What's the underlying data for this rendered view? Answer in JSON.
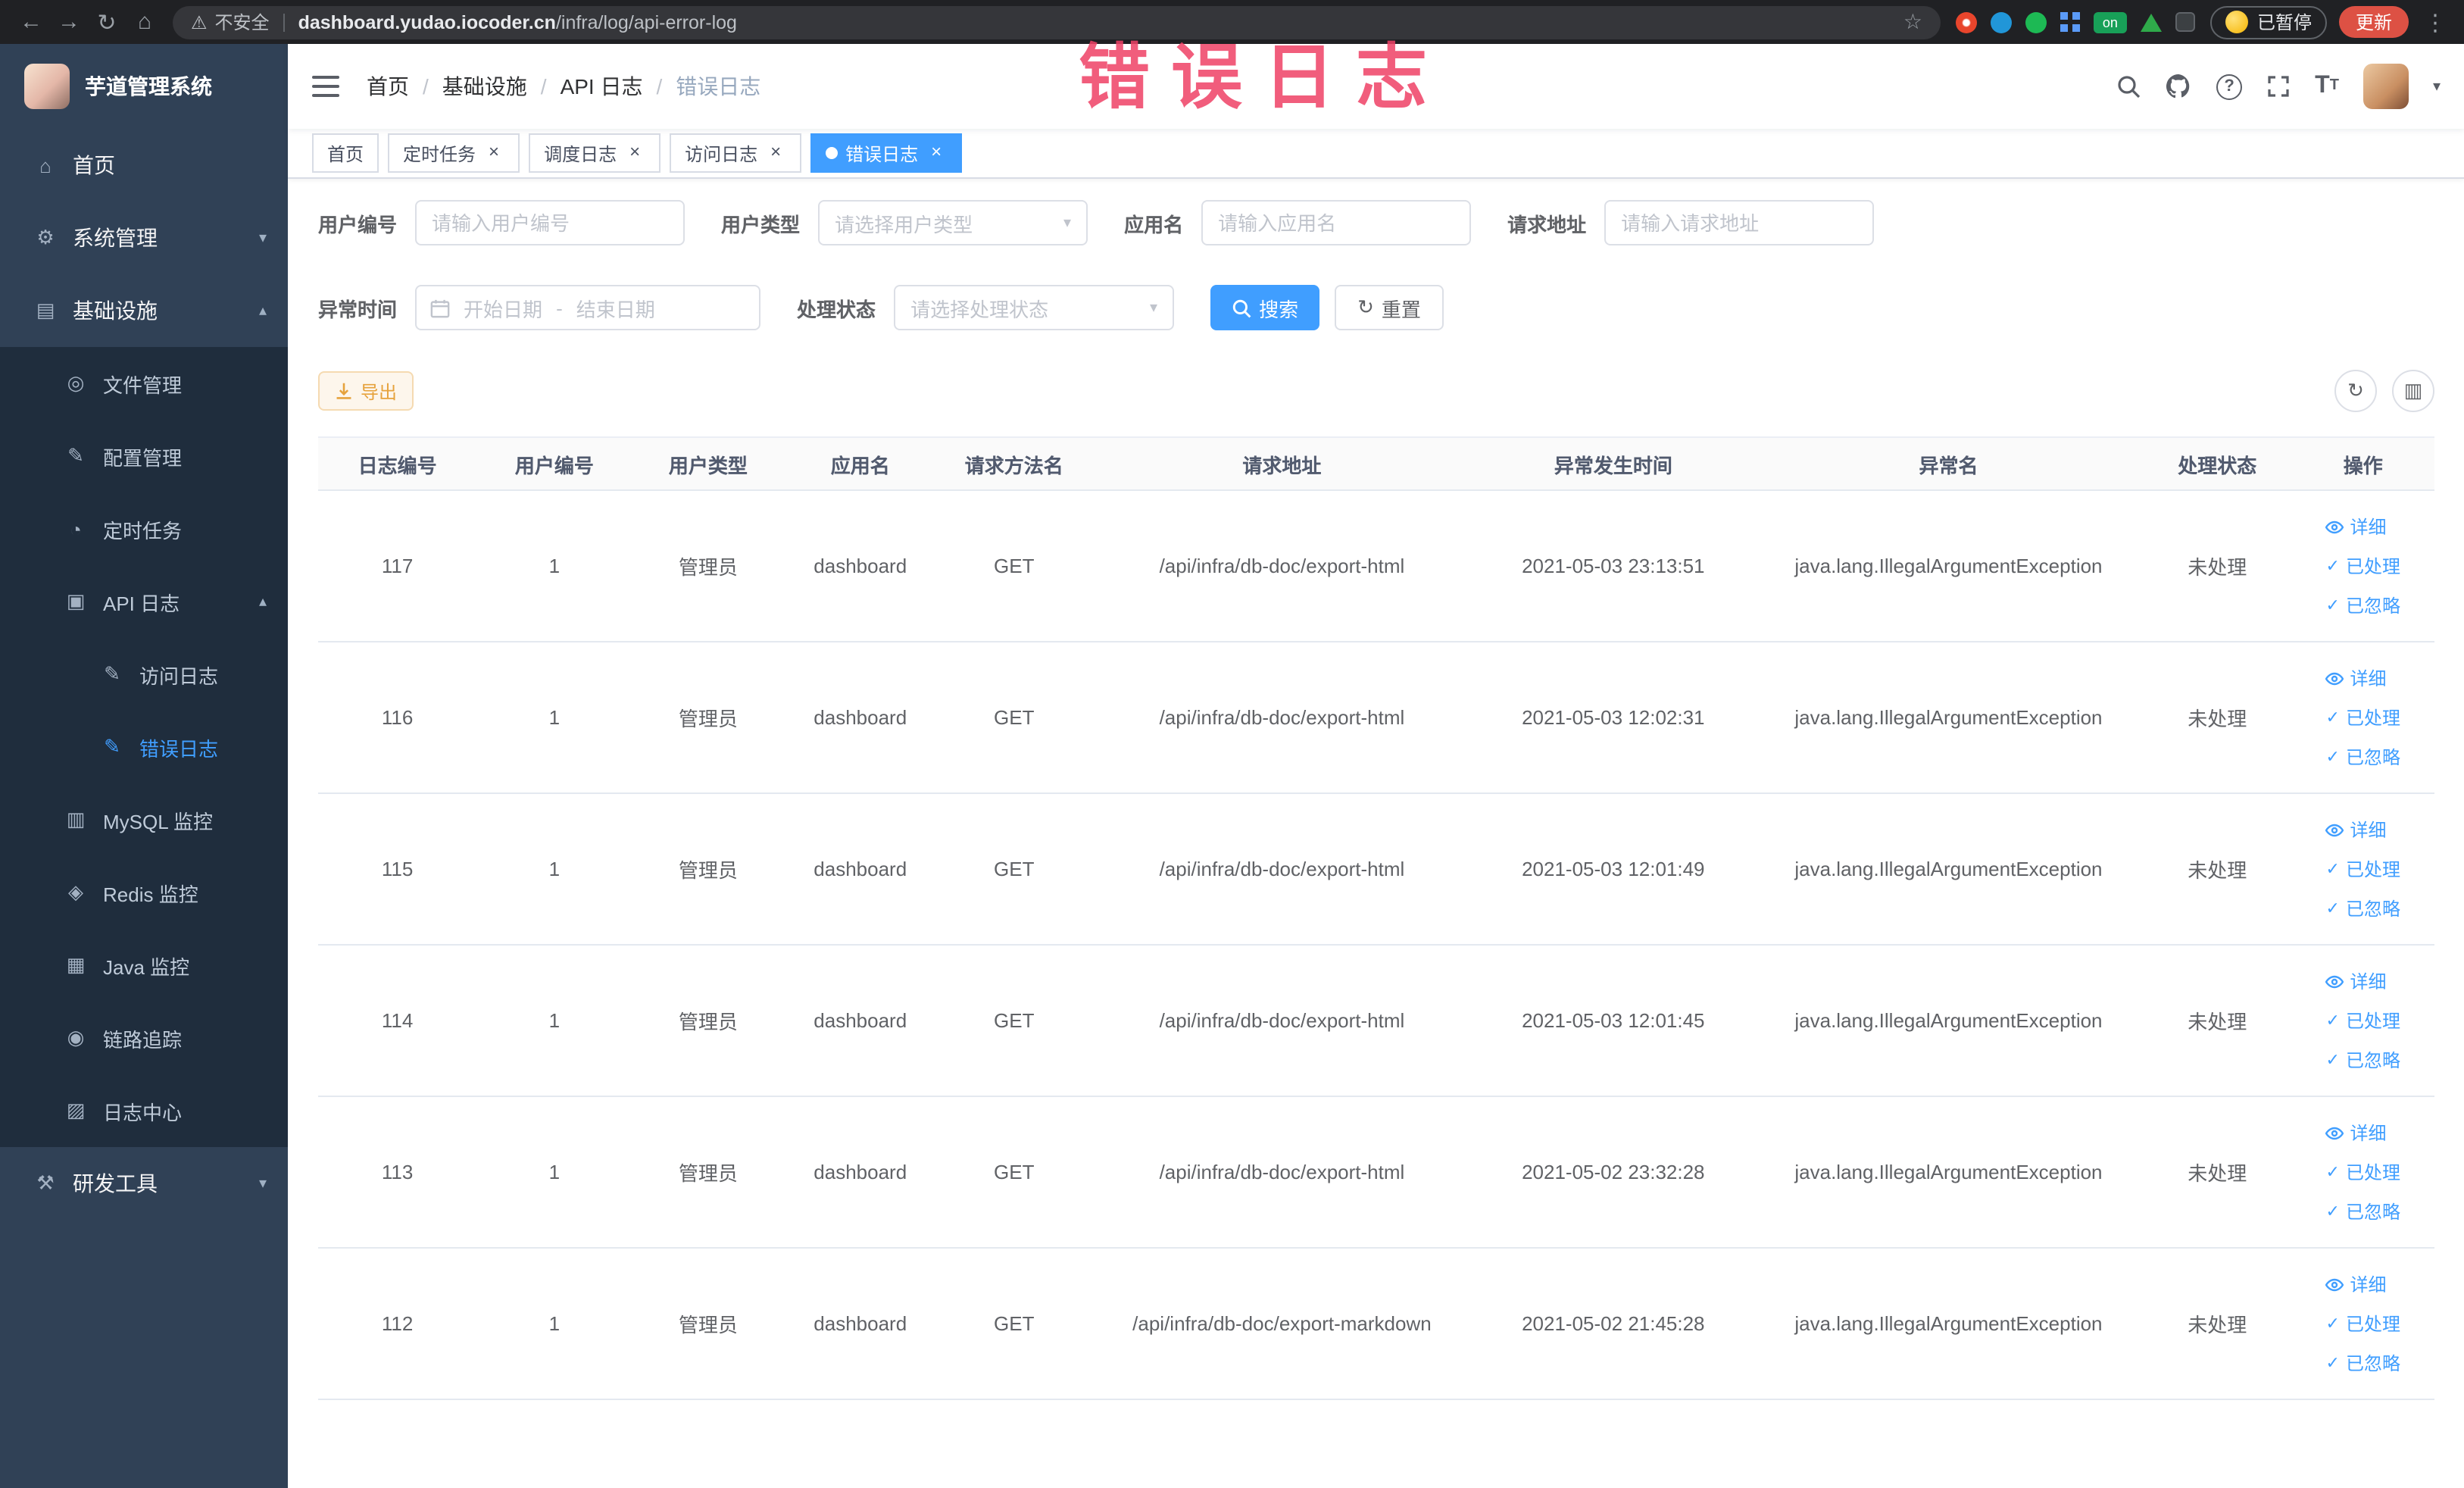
{
  "colors": {
    "accent": "#409eff",
    "sidebar_bg": "#304156",
    "submenu_bg": "#1f2d3d",
    "warning": "#e6a23c",
    "update_pill": "#dd5144"
  },
  "browser": {
    "security_label": "不安全",
    "url_host": "dashboard.yudao.iocoder.cn",
    "url_path": "/infra/log/api-error-log",
    "profile_paused_label": "已暂停",
    "update_label": "更新",
    "extension_badge": "on"
  },
  "annotation": {
    "title": "错误日志"
  },
  "icons": {
    "back": "←",
    "forward": "→",
    "reload": "↻",
    "home": "⌂",
    "warning": "⚠",
    "star": "☆",
    "menu_dots": "⋮",
    "close": "×",
    "caret_down": "▾",
    "chevron_down": "▾",
    "chevron_up": "▴",
    "refresh": "↻",
    "columns": "▥",
    "check": "✓",
    "font_size": "T",
    "help": "?"
  },
  "sidebar": {
    "logo_title": "芋道管理系统",
    "items": [
      {
        "key": "home",
        "label": "首页",
        "glyph": "⌂",
        "level": 1
      },
      {
        "key": "system",
        "label": "系统管理",
        "glyph": "⚙",
        "level": 1,
        "chevron": "down"
      },
      {
        "key": "infra",
        "label": "基础设施",
        "glyph": "▤",
        "level": 1,
        "chevron": "up"
      },
      {
        "key": "file",
        "label": "文件管理",
        "glyph": "◎",
        "level": 2
      },
      {
        "key": "config",
        "label": "配置管理",
        "glyph": "✎",
        "level": 2
      },
      {
        "key": "job",
        "label": "定时任务",
        "glyph": "◔",
        "level": 2
      },
      {
        "key": "api-log",
        "label": "API 日志",
        "glyph": "▣",
        "level": 2,
        "chevron": "up"
      },
      {
        "key": "access-log",
        "label": "访问日志",
        "glyph": "✎",
        "level": 3
      },
      {
        "key": "error-log",
        "label": "错误日志",
        "glyph": "✎",
        "level": 3,
        "active": true
      },
      {
        "key": "mysql",
        "label": "MySQL 监控",
        "glyph": "▥",
        "level": 2
      },
      {
        "key": "redis",
        "label": "Redis 监控",
        "glyph": "◈",
        "level": 2
      },
      {
        "key": "java",
        "label": "Java 监控",
        "glyph": "▦",
        "level": 2
      },
      {
        "key": "trace",
        "label": "链路追踪",
        "glyph": "◉",
        "level": 2
      },
      {
        "key": "log-center",
        "label": "日志中心",
        "glyph": "▨",
        "level": 2
      },
      {
        "key": "dev-tools",
        "label": "研发工具",
        "glyph": "⚒",
        "level": 1,
        "chevron": "down"
      }
    ]
  },
  "navbar": {
    "breadcrumb": {
      "separator": "/",
      "items": [
        "首页",
        "基础设施",
        "API 日志",
        "错误日志"
      ]
    }
  },
  "tabs": [
    {
      "key": "home",
      "label": "首页",
      "closable": false,
      "active": false
    },
    {
      "key": "job",
      "label": "定时任务",
      "closable": true,
      "active": false
    },
    {
      "key": "job-log",
      "label": "调度日志",
      "closable": true,
      "active": false
    },
    {
      "key": "access-log",
      "label": "访问日志",
      "closable": true,
      "active": false
    },
    {
      "key": "error-log",
      "label": "错误日志",
      "closable": true,
      "active": true
    }
  ],
  "filters": {
    "user_id_label": "用户编号",
    "user_id_placeholder": "请输入用户编号",
    "user_type_label": "用户类型",
    "user_type_placeholder": "请选择用户类型",
    "app_name_label": "应用名",
    "app_name_placeholder": "请输入应用名",
    "request_url_label": "请求地址",
    "request_url_placeholder": "请输入请求地址",
    "exception_time_label": "异常时间",
    "start_date_placeholder": "开始日期",
    "range_separator": "-",
    "end_date_placeholder": "结束日期",
    "process_status_label": "处理状态",
    "process_status_placeholder": "请选择处理状态",
    "search_label": "搜索",
    "reset_label": "重置"
  },
  "toolbar": {
    "export_label": "导出"
  },
  "table": {
    "columns": [
      "日志编号",
      "用户编号",
      "用户类型",
      "应用名",
      "请求方法名",
      "请求地址",
      "异常发生时间",
      "异常名",
      "处理状态",
      "操作"
    ],
    "actions": [
      "详细",
      "已处理",
      "已忽略"
    ],
    "rows": [
      {
        "id": "117",
        "user_id": "1",
        "user_type": "管理员",
        "app": "dashboard",
        "method": "GET",
        "url": "/api/infra/db-doc/export-html",
        "time": "2021-05-03 23:13:51",
        "exception": "java.lang.IllegalArgumentException",
        "status": "未处理"
      },
      {
        "id": "116",
        "user_id": "1",
        "user_type": "管理员",
        "app": "dashboard",
        "method": "GET",
        "url": "/api/infra/db-doc/export-html",
        "time": "2021-05-03 12:02:31",
        "exception": "java.lang.IllegalArgumentException",
        "status": "未处理"
      },
      {
        "id": "115",
        "user_id": "1",
        "user_type": "管理员",
        "app": "dashboard",
        "method": "GET",
        "url": "/api/infra/db-doc/export-html",
        "time": "2021-05-03 12:01:49",
        "exception": "java.lang.IllegalArgumentException",
        "status": "未处理"
      },
      {
        "id": "114",
        "user_id": "1",
        "user_type": "管理员",
        "app": "dashboard",
        "method": "GET",
        "url": "/api/infra/db-doc/export-html",
        "time": "2021-05-03 12:01:45",
        "exception": "java.lang.IllegalArgumentException",
        "status": "未处理"
      },
      {
        "id": "113",
        "user_id": "1",
        "user_type": "管理员",
        "app": "dashboard",
        "method": "GET",
        "url": "/api/infra/db-doc/export-html",
        "time": "2021-05-02 23:32:28",
        "exception": "java.lang.IllegalArgumentException",
        "status": "未处理"
      },
      {
        "id": "112",
        "user_id": "1",
        "user_type": "管理员",
        "app": "dashboard",
        "method": "GET",
        "url": "/api/infra/db-doc/export-markdown",
        "time": "2021-05-02 21:45:28",
        "exception": "java.lang.IllegalArgumentException",
        "status": "未处理"
      }
    ]
  }
}
